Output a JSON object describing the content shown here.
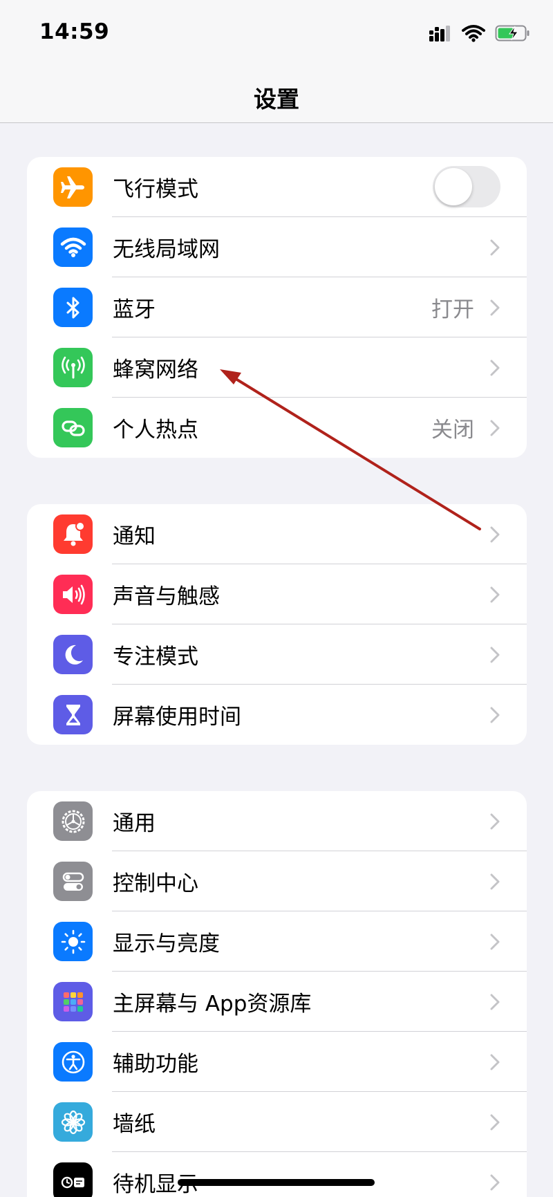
{
  "status_bar": {
    "time": "14:59"
  },
  "nav": {
    "title": "设置"
  },
  "groups": [
    {
      "rows": [
        {
          "label": "飞行模式",
          "icon": "airplane-icon",
          "color": "#ff9500",
          "control": "toggle",
          "toggle_on": false
        },
        {
          "label": "无线局域网",
          "icon": "wifi-icon",
          "color": "#0a7aff",
          "control": "chevron"
        },
        {
          "label": "蓝牙",
          "icon": "bluetooth-icon",
          "color": "#0a7aff",
          "value": "打开",
          "control": "chevron"
        },
        {
          "label": "蜂窝网络",
          "icon": "cellular-antenna-icon",
          "color": "#34c759",
          "control": "chevron"
        },
        {
          "label": "个人热点",
          "icon": "hotspot-link-icon",
          "color": "#34c759",
          "value": "关闭",
          "control": "chevron"
        }
      ]
    },
    {
      "rows": [
        {
          "label": "通知",
          "icon": "notification-bell-icon",
          "color": "#ff3b30",
          "control": "chevron"
        },
        {
          "label": "声音与触感",
          "icon": "speaker-icon",
          "color": "#ff2d55",
          "control": "chevron"
        },
        {
          "label": "专注模式",
          "icon": "moon-icon",
          "color": "#5e5ce6",
          "control": "chevron"
        },
        {
          "label": "屏幕使用时间",
          "icon": "hourglass-icon",
          "color": "#5e5ce6",
          "control": "chevron"
        }
      ]
    },
    {
      "rows": [
        {
          "label": "通用",
          "icon": "gear-icon",
          "color": "#8e8e93",
          "control": "chevron"
        },
        {
          "label": "控制中心",
          "icon": "toggles-icon",
          "color": "#8e8e93",
          "control": "chevron"
        },
        {
          "label": "显示与亮度",
          "icon": "sun-icon",
          "color": "#0a7aff",
          "control": "chevron"
        },
        {
          "label": "主屏幕与 App资源库",
          "icon": "app-grid-icon",
          "color": "#5e5ce6",
          "control": "chevron"
        },
        {
          "label": "辅助功能",
          "icon": "accessibility-icon",
          "color": "#0a7aff",
          "control": "chevron"
        },
        {
          "label": "墙纸",
          "icon": "flower-icon",
          "color": "#35aadc",
          "control": "chevron"
        },
        {
          "label": "待机显示",
          "icon": "standby-icon",
          "color": "#000000",
          "control": "chevron"
        }
      ]
    }
  ],
  "annotation": {
    "color": "#b0221b",
    "points_to": "蜂窝网络"
  }
}
